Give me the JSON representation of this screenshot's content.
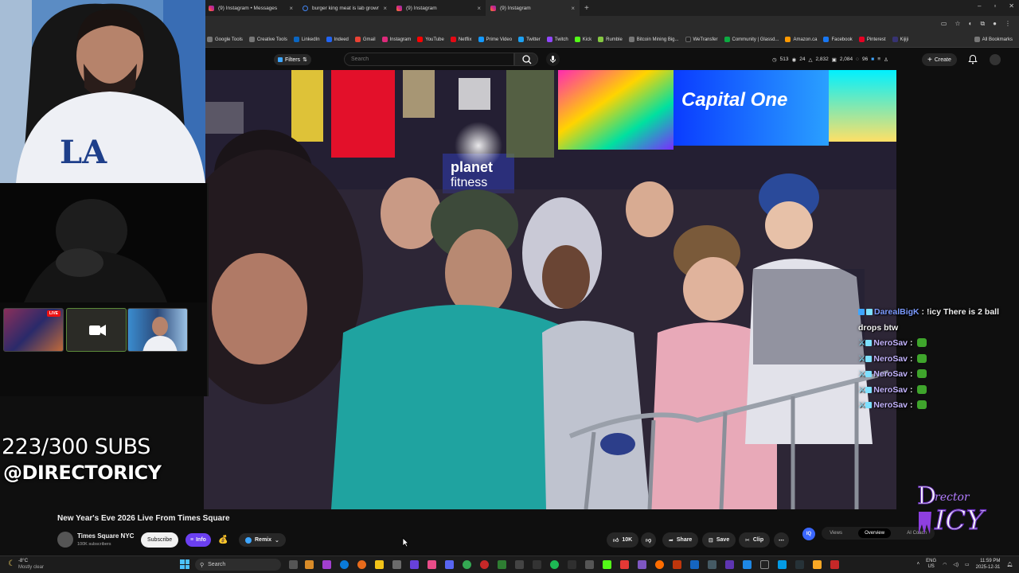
{
  "browser": {
    "tabs": [
      {
        "title": "(9) Instagram • Messages",
        "icon": "instagram-icon"
      },
      {
        "title": "burger king meat is lab grown",
        "icon": "google-icon"
      },
      {
        "title": "(9) Instagram",
        "icon": "instagram-icon"
      },
      {
        "title": "(9) Instagram",
        "icon": "instagram-icon"
      }
    ],
    "bookmarks": [
      "Google Tools",
      "Creative Tools",
      "LinkedIn",
      "Indeed",
      "Gmail",
      "Instagram",
      "YouTube",
      "Netflix",
      "Prime Video",
      "Twitter",
      "Twitch",
      "Kick",
      "Rumble",
      "Bitcoin Mining Big...",
      "WeTransfer",
      "Community | Glassd...",
      "Amazon.ca",
      "Facebook",
      "Pinterest",
      "Kijiji"
    ],
    "all_bookmarks": "All Bookmarks"
  },
  "youtube": {
    "filters_label": "Filters",
    "search_placeholder": "Search",
    "stats": {
      "s1": "513",
      "s2": "24",
      "s3": "2,832",
      "s4": "2,084",
      "s5": "96"
    },
    "create_label": "Create",
    "video_title": "New Year's Eve 2026 Live From Times Square",
    "channel_name": "Times Square NYC",
    "channel_subs": "100K subscribers",
    "subscribe_label": "Subscribe",
    "info_label": "Info",
    "remix_label": "Remix",
    "likes": "10K",
    "share_label": "Share",
    "save_label": "Save",
    "clip_label": "Clip",
    "tabs": [
      "Views",
      "Overview",
      "AI Coach"
    ],
    "ai_badge": "IQ"
  },
  "overlay": {
    "subs_goal": "223/300 SUBS",
    "handle": "@DIRECTORICY",
    "chat": [
      {
        "user": "DarealBigK",
        "msg": "!icy There is 2 ball drops btw",
        "emote": false
      },
      {
        "user": "NeroSav",
        "msg": "",
        "emote": true
      },
      {
        "user": "NeroSav",
        "msg": "",
        "emote": true
      },
      {
        "user": "NeroSav",
        "msg": "",
        "emote": true
      },
      {
        "user": "NeroSav",
        "msg": "",
        "emote": true
      },
      {
        "user": "NeroSav",
        "msg": "",
        "emote": true
      }
    ],
    "live_badge": "LIVE"
  },
  "taskbar": {
    "weather_temp": "-8°C",
    "weather_desc": "Mostly clear",
    "search_label": "Search",
    "lang": "ENG",
    "region": "US",
    "time": "11:59 PM",
    "date": "2025-12-31"
  },
  "colors": {
    "accent": "#3ea6ff",
    "info_purple": "#6b3ff0",
    "live_red": "#e11111"
  }
}
